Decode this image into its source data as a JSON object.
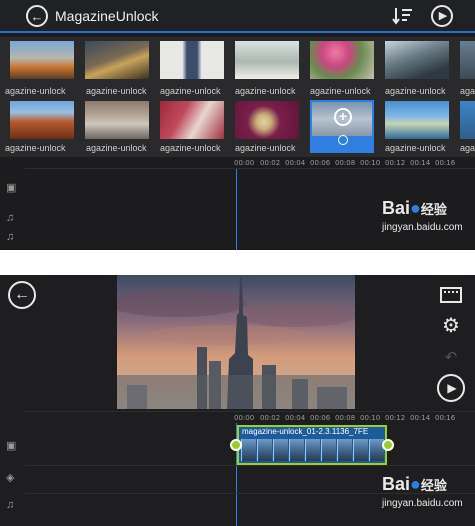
{
  "top": {
    "title": "MagazineUnlock",
    "icons": {
      "back": "back-arrow-icon",
      "sort": "sort-icon",
      "play": "play-icon"
    },
    "thumb_label": "agazine-unlock",
    "ruler": [
      "00:00",
      "00:02",
      "00:04",
      "00:06",
      "00:08",
      "00:10",
      "00:12",
      "00:14",
      "00:16"
    ],
    "selected_index": 9
  },
  "bottom": {
    "ruler": [
      "00:00",
      "00:02",
      "00:04",
      "00:06",
      "00:08",
      "00:10",
      "00:12",
      "00:14",
      "00:16"
    ],
    "clip_label": "magazine-unlock_01-2.3.1136_7FE",
    "icons": {
      "back": "back-arrow-icon",
      "film": "film-icon",
      "settings": "gear-icon",
      "undo": "undo-icon",
      "play": "play-icon"
    }
  },
  "watermark": {
    "logo_text": "Bai",
    "logo_text2": "经验",
    "url": "jingyan.baidu.com"
  },
  "colors": {
    "accent": "#2f7fe0",
    "clip_border": "#9ccf2a",
    "bg_dark": "#1c1c1e"
  }
}
